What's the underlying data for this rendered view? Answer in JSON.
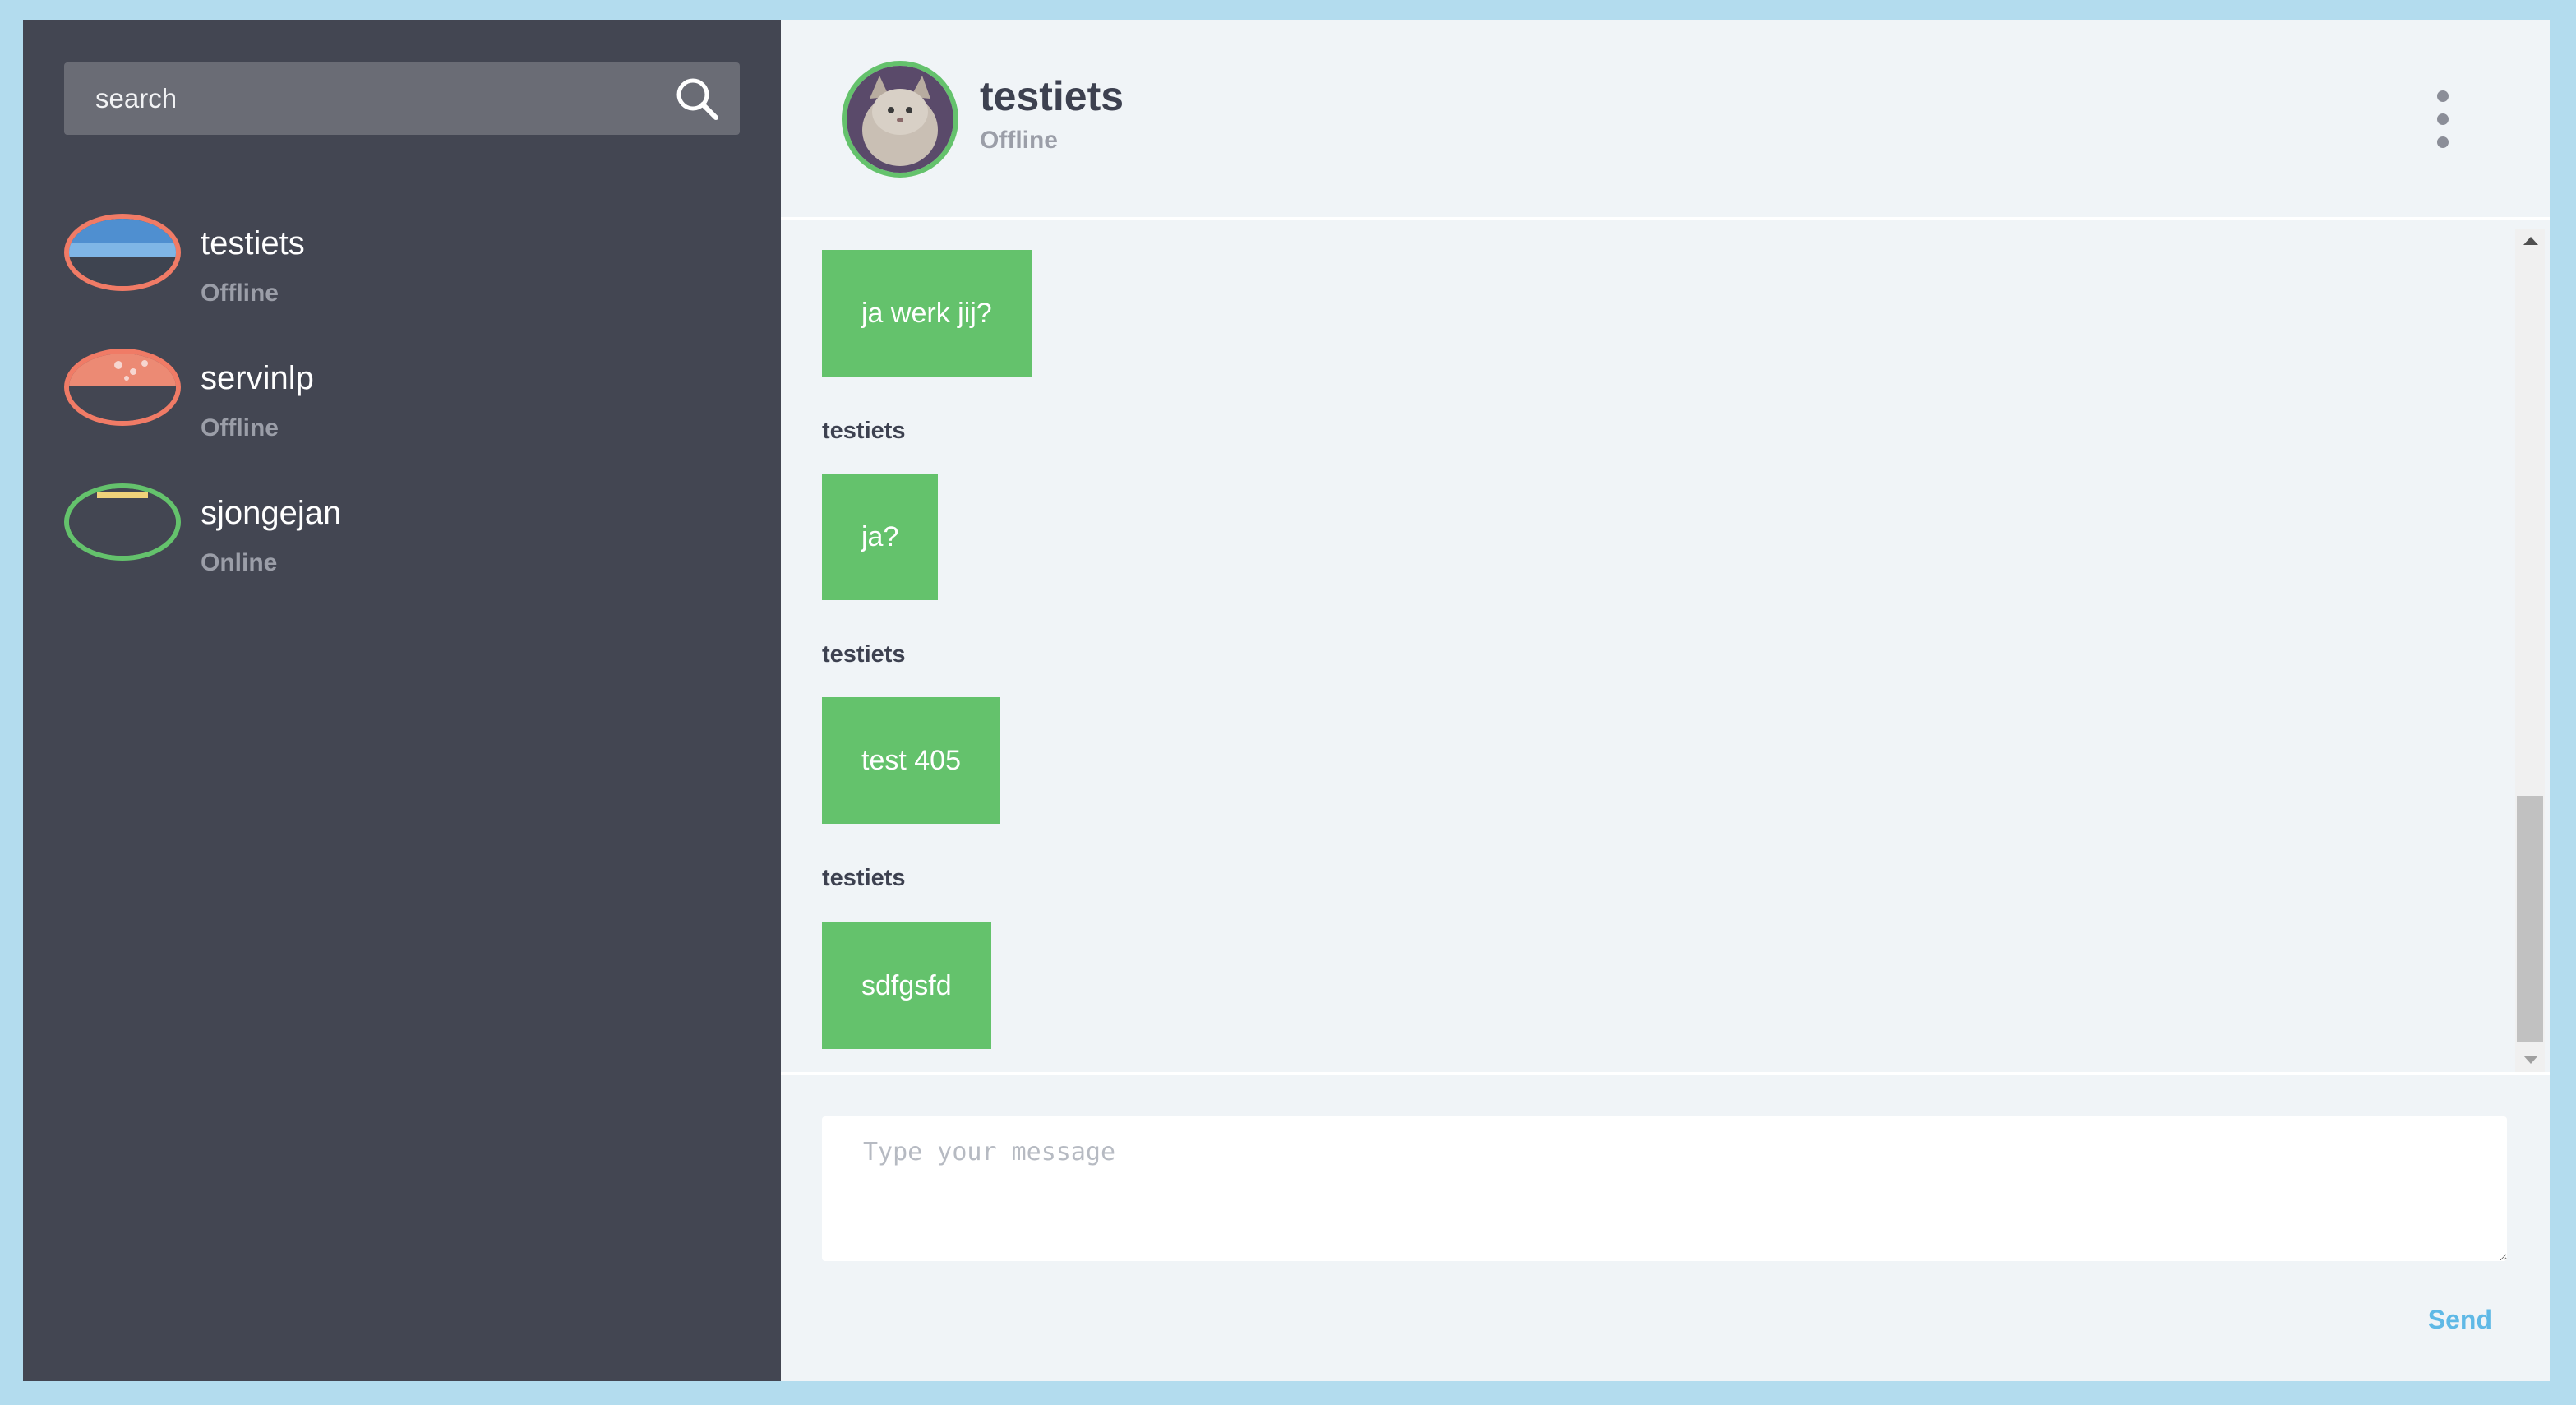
{
  "search": {
    "placeholder": "search"
  },
  "contacts": [
    {
      "name": "testiets",
      "status": "Offline",
      "ring_color": "#f07b66"
    },
    {
      "name": "servinlp",
      "status": "Offline",
      "ring_color": "#f07b66"
    },
    {
      "name": "sjongejan",
      "status": "Online",
      "ring_color": "#64c26c"
    }
  ],
  "chat": {
    "title": "testiets",
    "status": "Offline",
    "messages": [
      {
        "sender": "",
        "text": "ja werk jij?"
      },
      {
        "sender": "testiets",
        "text": "ja?"
      },
      {
        "sender": "testiets",
        "text": "test 405"
      },
      {
        "sender": "testiets",
        "text": "sdfgsfd"
      }
    ]
  },
  "composer": {
    "placeholder": "Type your message",
    "send_label": "Send"
  },
  "colors": {
    "sidebar_bg": "#434652",
    "bubble": "#64c26c",
    "offline_ring": "#f07b66",
    "online_ring": "#64c26c",
    "accent": "#5fb9e6"
  }
}
